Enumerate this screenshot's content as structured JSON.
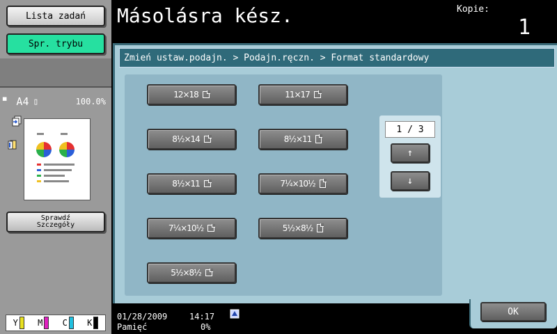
{
  "left_panel": {
    "jobs_button": "Lista zadań",
    "mode_button": "Spr. trybu",
    "preview": {
      "paper_size": "A4",
      "zoom": "100.0%"
    },
    "details_button_line1": "Sprawdź",
    "details_button_line2": "Szczegóły",
    "toner": [
      {
        "label": "Y",
        "color": "#e8e020"
      },
      {
        "label": "M",
        "color": "#e020c0"
      },
      {
        "label": "C",
        "color": "#20c0e0"
      },
      {
        "label": "K",
        "color": "#000000"
      }
    ]
  },
  "header": {
    "title": "Másolásra kész.",
    "copies_label": "Kopie:",
    "copies_value": "1"
  },
  "breadcrumb": "Zmień ustaw.podajn. > Podajn.ręczn. > Format standardowy",
  "sizes": [
    {
      "label": "12×18"
    },
    {
      "label": "11×17"
    },
    {
      "label": "8½×14"
    },
    {
      "label": "8½×11"
    },
    {
      "label": "8½×11"
    },
    {
      "label": "7¼×10½"
    },
    {
      "label": "7¼×10½"
    },
    {
      "label": "5½×8½"
    },
    {
      "label": "5½×8½"
    }
  ],
  "pager": {
    "indicator": "1 / 3",
    "up": "↑",
    "down": "↓"
  },
  "status": {
    "date": "01/28/2009",
    "time": "14:17",
    "memory_label": "Pamięć",
    "memory_value": "0%"
  },
  "ok_button": "OK",
  "colors": {
    "accent_green": "#26e0a0",
    "panel_blue": "#a8ccd8",
    "header_teal": "#2f6a7a"
  }
}
